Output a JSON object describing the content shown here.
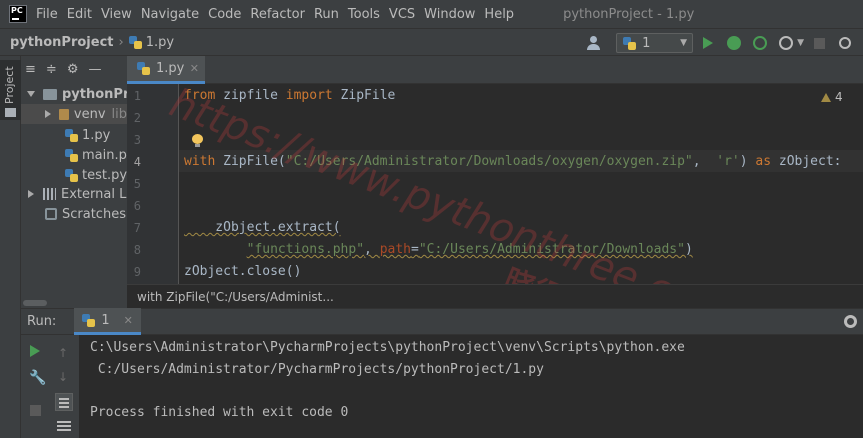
{
  "menubar": {
    "logo_text": "PC",
    "items": [
      "File",
      "Edit",
      "View",
      "Navigate",
      "Code",
      "Refactor",
      "Run",
      "Tools",
      "VCS",
      "Window",
      "Help"
    ],
    "window_title": "pythonProject - 1.py"
  },
  "navbar": {
    "project": "pythonProject",
    "separator": "›",
    "file": "1.py",
    "run_config": "1"
  },
  "sidebar": {
    "project_tab": "Project"
  },
  "project_tree": {
    "root": "pythonProject",
    "venv": "venv",
    "venv_suffix": "lib",
    "files": [
      "1.py",
      "main.py",
      "test.py"
    ],
    "external": "External Li",
    "scratches": "Scratches a"
  },
  "editor": {
    "tab": "1.py",
    "warning_count": "4",
    "line_numbers": [
      "1",
      "2",
      "3",
      "4",
      "5",
      "6",
      "7",
      "8",
      "9"
    ],
    "breadcrumb": "with ZipFile(\"C:/Users/Administ...",
    "code": {
      "l1_kw1": "from",
      "l1_mod": " zipfile ",
      "l1_kw2": "import",
      "l1_name": " ZipFile",
      "l4_kw": "with",
      "l4_call": " ZipFile(",
      "l4_str": "\"C:/Users/Administrator/Downloads/oxygen/oxygen.zip\"",
      "l4_comma": ",  ",
      "l4_mode": "'r'",
      "l4_paren": ") ",
      "l4_as": "as",
      "l4_tail": " zObject:",
      "l7": "    zObject.extract(",
      "l8_indent": "        ",
      "l8_str1": "\"functions.php\"",
      "l8_comma": ", ",
      "l8_param": "path",
      "l8_eq": "=",
      "l8_str2": "\"C:/Users/Administrator/Downloads\"",
      "l8_close": ")",
      "l9": "zObject.close()"
    }
  },
  "watermark": {
    "url": "https://www.pythonthree.com/",
    "cn": "晓得博客"
  },
  "run_panel": {
    "label": "Run:",
    "tab": "1",
    "console": [
      "C:\\Users\\Administrator\\PycharmProjects\\pythonProject\\venv\\Scripts\\python.exe",
      " C:/Users/Administrator/PycharmProjects/pythonProject/1.py",
      "",
      "Process finished with exit code 0"
    ]
  }
}
